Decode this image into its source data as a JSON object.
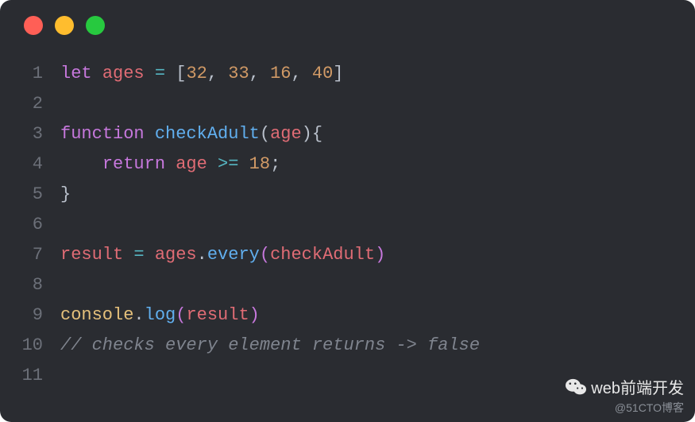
{
  "window": {
    "traffic_lights": [
      "red",
      "yellow",
      "green"
    ]
  },
  "code": {
    "lines": [
      {
        "n": "1",
        "tokens": [
          {
            "c": "kw",
            "t": "let"
          },
          {
            "c": "punc",
            "t": " "
          },
          {
            "c": "var",
            "t": "ages"
          },
          {
            "c": "punc",
            "t": " "
          },
          {
            "c": "op",
            "t": "="
          },
          {
            "c": "punc",
            "t": " ["
          },
          {
            "c": "num",
            "t": "32"
          },
          {
            "c": "punc",
            "t": ", "
          },
          {
            "c": "num",
            "t": "33"
          },
          {
            "c": "punc",
            "t": ", "
          },
          {
            "c": "num",
            "t": "16"
          },
          {
            "c": "punc",
            "t": ", "
          },
          {
            "c": "num",
            "t": "40"
          },
          {
            "c": "punc",
            "t": "]"
          }
        ]
      },
      {
        "n": "2",
        "tokens": []
      },
      {
        "n": "3",
        "tokens": [
          {
            "c": "kw",
            "t": "function"
          },
          {
            "c": "punc",
            "t": " "
          },
          {
            "c": "fn",
            "t": "checkAdult"
          },
          {
            "c": "punc",
            "t": "("
          },
          {
            "c": "var",
            "t": "age"
          },
          {
            "c": "punc",
            "t": "){"
          }
        ]
      },
      {
        "n": "4",
        "tokens": [
          {
            "c": "punc",
            "t": "    "
          },
          {
            "c": "kw",
            "t": "return"
          },
          {
            "c": "punc",
            "t": " "
          },
          {
            "c": "var",
            "t": "age"
          },
          {
            "c": "punc",
            "t": " "
          },
          {
            "c": "op",
            "t": ">="
          },
          {
            "c": "punc",
            "t": " "
          },
          {
            "c": "num",
            "t": "18"
          },
          {
            "c": "punc",
            "t": ";"
          }
        ]
      },
      {
        "n": "5",
        "tokens": [
          {
            "c": "punc",
            "t": "}"
          }
        ]
      },
      {
        "n": "6",
        "tokens": []
      },
      {
        "n": "7",
        "tokens": [
          {
            "c": "var",
            "t": "result"
          },
          {
            "c": "punc",
            "t": " "
          },
          {
            "c": "op",
            "t": "="
          },
          {
            "c": "punc",
            "t": " "
          },
          {
            "c": "var",
            "t": "ages"
          },
          {
            "c": "punc",
            "t": "."
          },
          {
            "c": "fn",
            "t": "every"
          },
          {
            "c": "paren",
            "t": "("
          },
          {
            "c": "var",
            "t": "checkAdult"
          },
          {
            "c": "paren",
            "t": ")"
          }
        ]
      },
      {
        "n": "8",
        "tokens": []
      },
      {
        "n": "9",
        "tokens": [
          {
            "c": "obj",
            "t": "console"
          },
          {
            "c": "punc",
            "t": "."
          },
          {
            "c": "fn",
            "t": "log"
          },
          {
            "c": "paren",
            "t": "("
          },
          {
            "c": "var",
            "t": "result"
          },
          {
            "c": "paren",
            "t": ")"
          }
        ]
      },
      {
        "n": "10",
        "tokens": [
          {
            "c": "cmt",
            "t": "// checks every element returns -> false"
          }
        ]
      },
      {
        "n": "11",
        "tokens": []
      }
    ]
  },
  "watermark": {
    "title": "web前端开发",
    "subtitle": "@51CTO博客"
  }
}
